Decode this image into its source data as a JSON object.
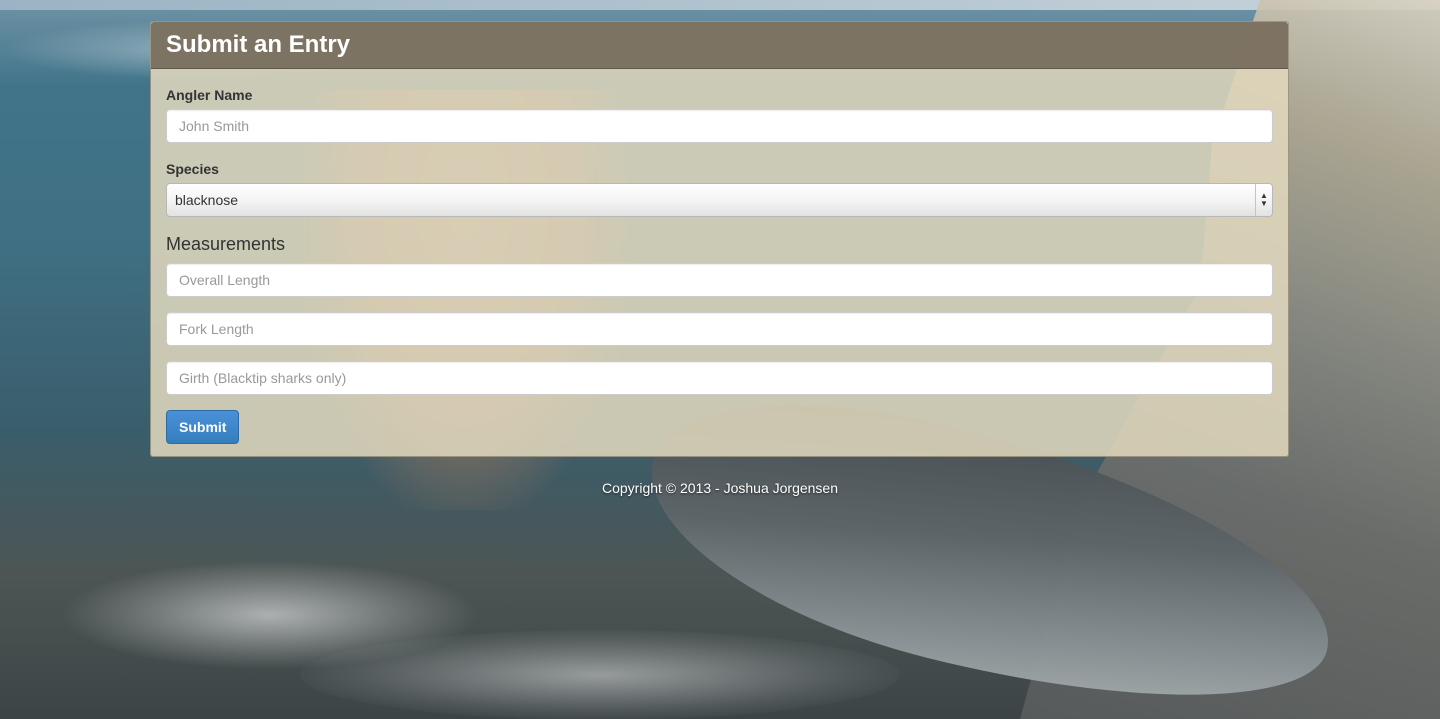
{
  "form": {
    "title": "Submit an Entry",
    "angler_label": "Angler Name",
    "angler_placeholder": "John Smith",
    "species_label": "Species",
    "species_selected": "blacknose",
    "measurements_title": "Measurements",
    "overall_length_placeholder": "Overall Length",
    "fork_length_placeholder": "Fork Length",
    "girth_placeholder": "Girth (Blacktip sharks only)",
    "submit_label": "Submit"
  },
  "footer": {
    "copyright": "Copyright © 2013 - Joshua Jorgensen"
  },
  "colors": {
    "panel_heading": "#766c5c",
    "panel_body": "#e2d8be",
    "primary": "#428bca"
  }
}
